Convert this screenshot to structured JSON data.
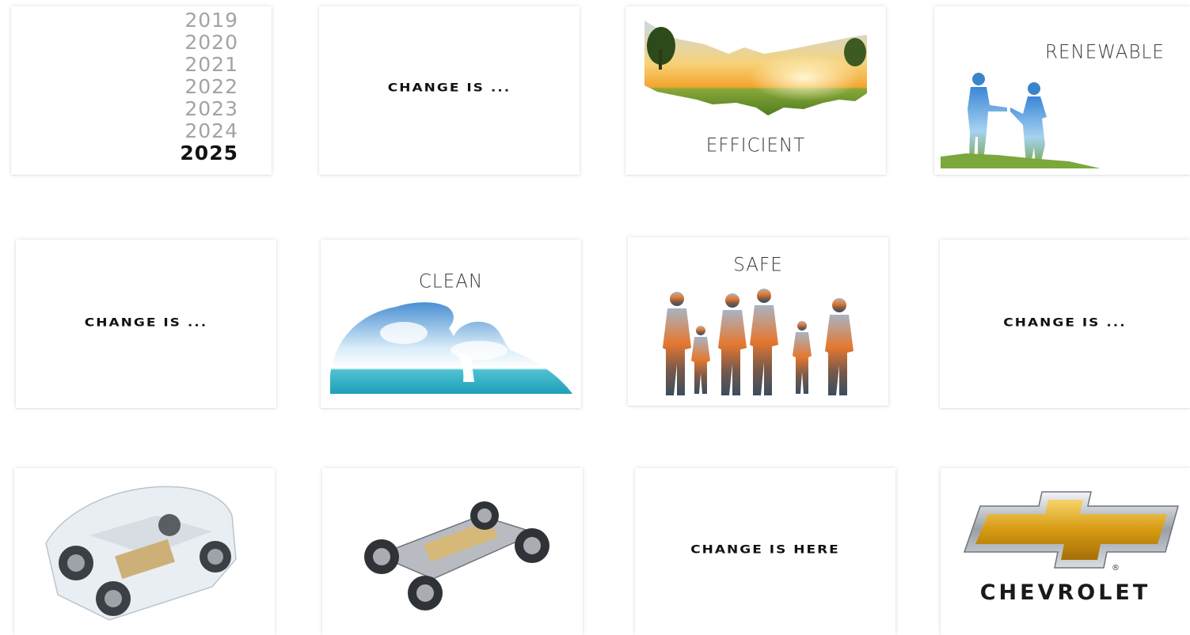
{
  "slides": {
    "years": {
      "items": [
        "2019",
        "2020",
        "2021",
        "2022",
        "2023",
        "2024"
      ],
      "current": "2025"
    },
    "change_is": "CHANGE IS ...",
    "efficient": "EFFICIENT",
    "renewable": "RENEWABLE",
    "clean": "CLEAN",
    "safe": "SAFE",
    "change_is_here": "CHANGE IS HERE",
    "brand": "CHEVROLET",
    "registered_mark": "®"
  },
  "colors": {
    "sky": "#8fc6ec",
    "sunset": "#f3b23a",
    "grass": "#6e9a2c",
    "sea": "#2fb2c8",
    "bowtie_gold": "#e2a81c",
    "chrome": "#c8ccd2"
  },
  "icons": [
    "landscape-silhouette-image",
    "couple-silhouette-image",
    "clouds-silhouette-image",
    "family-silhouette-image",
    "car-xray-image",
    "car-chassis-image",
    "chevrolet-bowtie-logo"
  ]
}
